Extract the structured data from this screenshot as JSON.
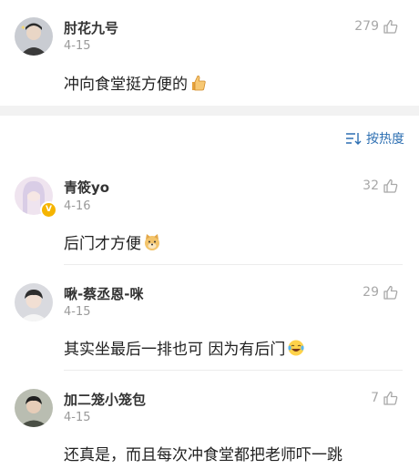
{
  "comments": [
    {
      "username": "肘花九号",
      "date": "4-15",
      "likes": "279",
      "text": "冲向食堂挺方便的",
      "emoji": "thumbs-up-icon",
      "verified": false
    },
    {
      "username": "青筱yo",
      "date": "4-16",
      "likes": "32",
      "text": "后门才方便",
      "emoji": "doge-icon",
      "verified": true
    },
    {
      "username": "啾-蔡丞恩-咪",
      "date": "4-15",
      "likes": "29",
      "text": "其实坐最后一排也可 因为有后门",
      "emoji": "laughing-tears-icon",
      "verified": false
    },
    {
      "username": "加二笼小笼包",
      "date": "4-15",
      "likes": "7",
      "text": "还真是，而且每次冲食堂都把老师吓一跳",
      "emoji": "",
      "verified": false
    }
  ],
  "sort": {
    "label": "按热度",
    "icon": "sort-icon"
  },
  "colors": {
    "accent": "#2d6fb2",
    "muted": "#9a9a9a",
    "separator": "#f2f2f2",
    "verified": "#f5b400"
  }
}
